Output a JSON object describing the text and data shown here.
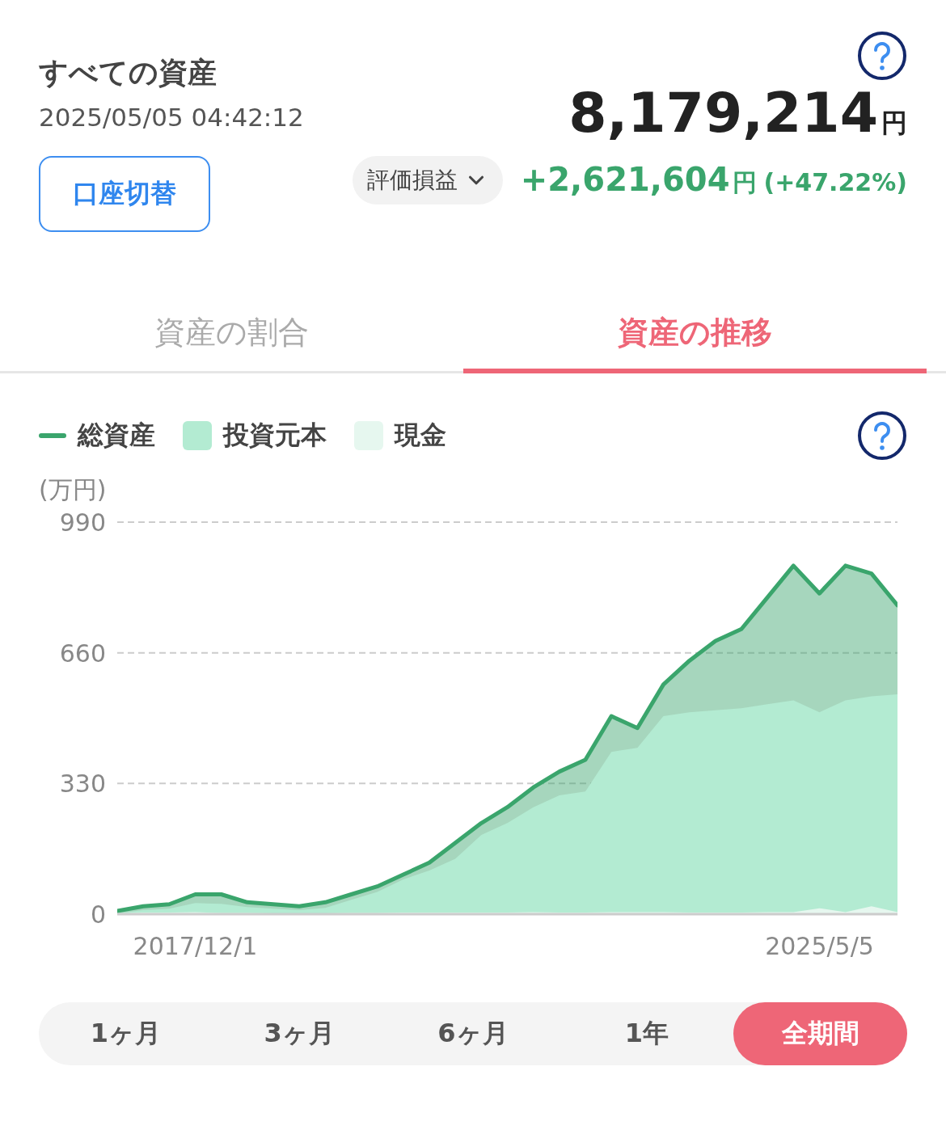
{
  "header": {
    "title": "すべての資産",
    "timestamp": "2025/05/05 04:42:12",
    "switch_button": "口座切替",
    "total": "8,179,214",
    "total_unit": "円",
    "metric_dropdown": "評価損益",
    "gain": "+2,621,604",
    "gain_unit": "円",
    "gain_percent": "(+47.22%)"
  },
  "tabs": [
    {
      "label": "資産の割合",
      "selected": false
    },
    {
      "label": "資産の推移",
      "selected": true
    }
  ],
  "legend": [
    {
      "kind": "line"
    },
    {
      "kind": "swatch"
    },
    {
      "kind": "swatch"
    }
  ],
  "chart_data": {
    "type": "area",
    "ylabel": "(万円)",
    "categories": [
      null,
      null,
      null,
      "2017/12/1",
      null,
      null,
      null,
      null,
      null,
      null,
      null,
      null,
      null,
      null,
      null,
      null,
      null,
      null,
      null,
      null,
      null,
      null,
      null,
      null,
      null,
      null,
      null,
      "2025/5/5",
      null,
      null,
      null
    ],
    "ylim": [
      0,
      990
    ],
    "yticks": [
      0,
      330,
      660,
      990
    ],
    "series": [
      {
        "name": "総資産",
        "color": "#3aa56c",
        "values": [
          8,
          20,
          25,
          50,
          50,
          30,
          25,
          20,
          30,
          50,
          70,
          100,
          130,
          180,
          230,
          270,
          320,
          360,
          390,
          500,
          470,
          580,
          640,
          690,
          720,
          800,
          880,
          810,
          880,
          860,
          780
        ]
      },
      {
        "name": "投資元本",
        "color": "#b3ebd2",
        "values": [
          2,
          10,
          14,
          28,
          26,
          18,
          14,
          10,
          16,
          36,
          56,
          88,
          110,
          140,
          200,
          230,
          270,
          300,
          310,
          410,
          420,
          500,
          510,
          515,
          520,
          530,
          540,
          510,
          540,
          550,
          555
        ]
      },
      {
        "name": "現金",
        "color": "#e6f7ef",
        "values": [
          2,
          4,
          4,
          5,
          3,
          3,
          2,
          2,
          2,
          3,
          3,
          4,
          4,
          4,
          4,
          4,
          5,
          4,
          4,
          5,
          5,
          5,
          4,
          4,
          4,
          5,
          5,
          15,
          5,
          20,
          5
        ]
      }
    ]
  },
  "periods": [
    {
      "label": "1ヶ月",
      "selected": false
    },
    {
      "label": "3ヶ月",
      "selected": false
    },
    {
      "label": "6ヶ月",
      "selected": false
    },
    {
      "label": "1年",
      "selected": false
    },
    {
      "label": "全期間",
      "selected": true
    }
  ]
}
